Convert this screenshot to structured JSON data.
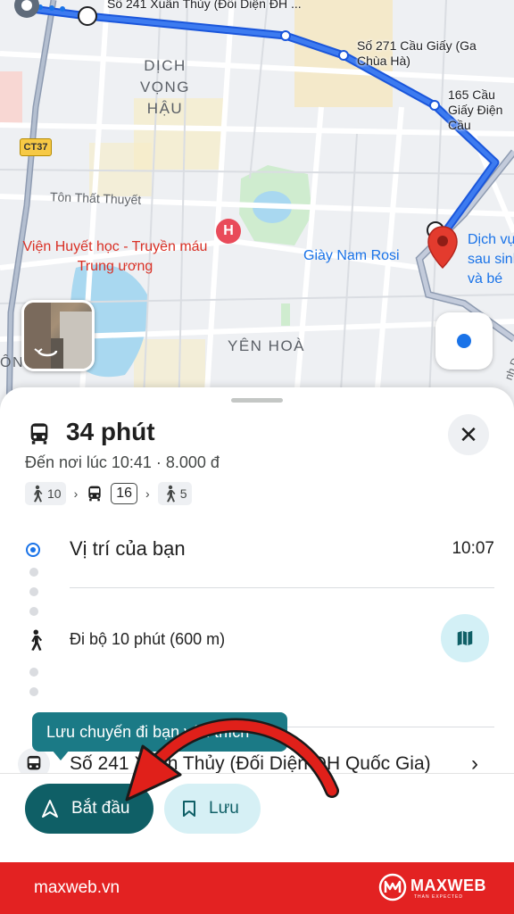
{
  "map": {
    "districts": {
      "dich_vong_hau": "DỊCH VỌNG HẬU",
      "yen_hoa": "YÊN HOÀ",
      "on": "ÔN"
    },
    "streets": {
      "ton_that_thuyet": "Tôn Thất Thuyết",
      "road_code": "CT37"
    },
    "pois": {
      "hospital": "Viện Huyết học - Truyền máu Trung ương",
      "hospital_letter": "H",
      "store": "Giày Nam Rosi",
      "destination_label": "Dịch vụ sau sinh và bé",
      "daily_label": "nh Dai"
    },
    "stops": {
      "s241": "Số 241 Xuân Thủy (Đối Diện ĐH ...",
      "s271": "Số 271 Cầu Giấy (Ga Chùa Hà)",
      "s165": "165 Cầu Giấy Điện Cầu"
    },
    "route_color": "#1a56db"
  },
  "trip": {
    "duration": "34 phút",
    "arrival": "Đến nơi lúc 10:41 · 8.000 đ",
    "walk_before": "10",
    "bus_number": "16",
    "walk_after": "5"
  },
  "timeline": {
    "origin_label": "Vị trí của bạn",
    "origin_time": "10:07",
    "walk_label": "Đi bộ 10 phút (600 m)",
    "stop_label": "Số 241 Xuân Thủy (Đối Diện ĐH Quốc Gia)"
  },
  "tooltip": {
    "text": "Lưu chuyến đi bạn yêu thích"
  },
  "actions": {
    "start_label": "Bắt đầu",
    "save_label": "Lưu"
  },
  "footer": {
    "url": "maxweb.vn",
    "brand": "MAXWEB",
    "tagline": "THAN EXPECTED"
  },
  "colors": {
    "accent": "#0f5f66",
    "footer_red": "#e32222",
    "pin_red": "#e33b2e",
    "location_blue": "#1a73e8"
  },
  "icons": [
    "bus-icon",
    "walk-icon",
    "close-icon",
    "map-icon",
    "navigation-icon",
    "bookmark-icon",
    "chevron-right-icon",
    "location-pin-icon"
  ]
}
